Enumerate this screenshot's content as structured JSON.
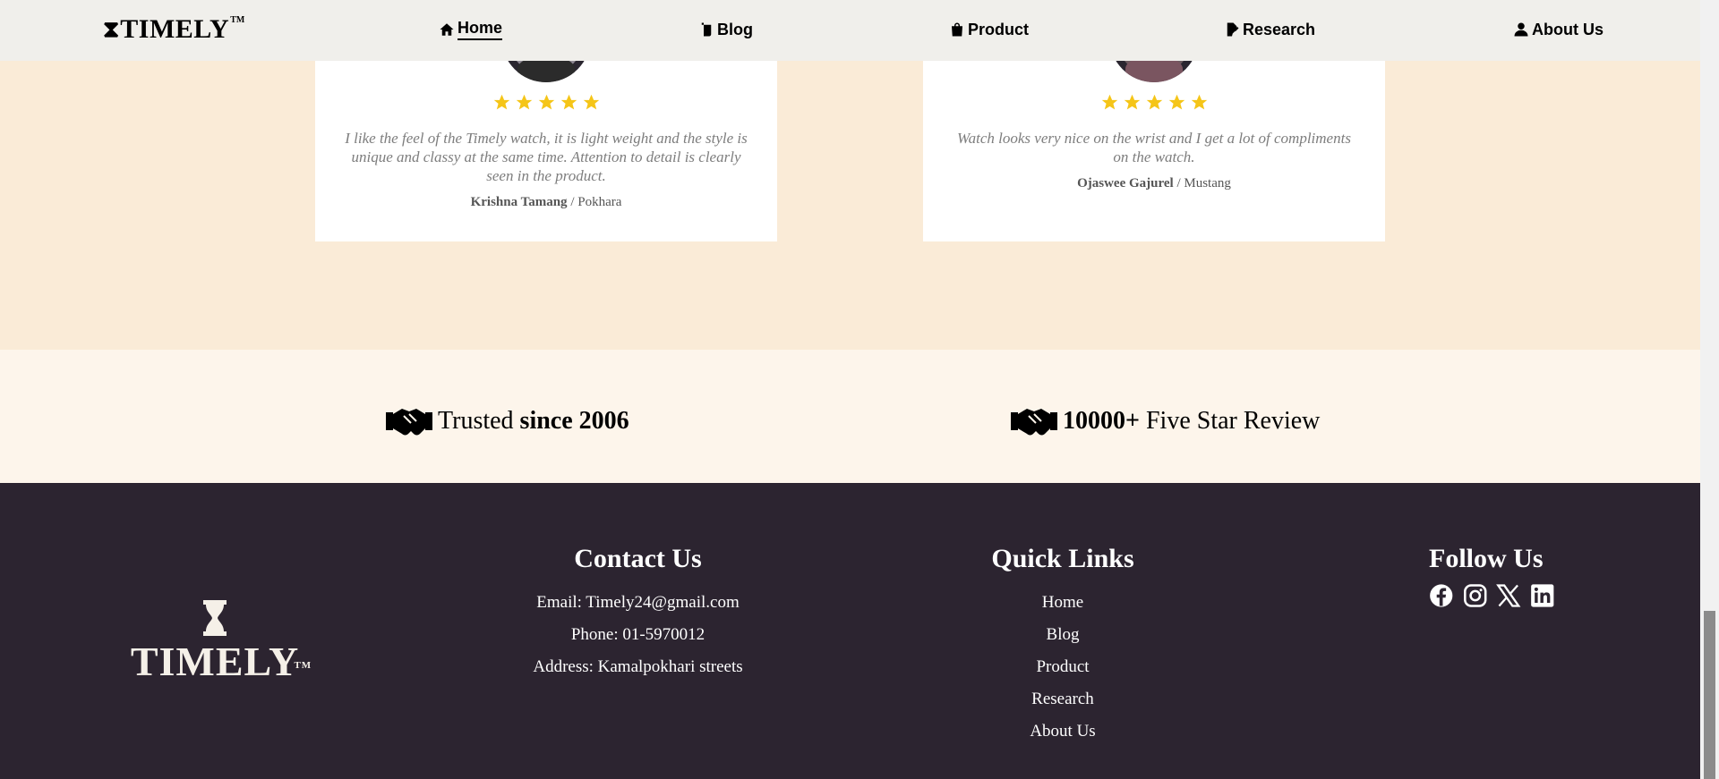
{
  "header": {
    "logo": {
      "text": "TIMELY",
      "tm": "TM"
    },
    "nav": [
      {
        "label": "Home",
        "icon": "home-icon",
        "active": true
      },
      {
        "label": "Blog",
        "icon": "blog-icon",
        "active": false
      },
      {
        "label": "Product",
        "icon": "shopping-bag-icon",
        "active": false
      },
      {
        "label": "Research",
        "icon": "research-doc-icon",
        "active": false
      },
      {
        "label": "About Us",
        "icon": "user-icon",
        "active": false
      }
    ]
  },
  "testimonials": [
    {
      "rating": 5,
      "quote": "I like the feel of the Timely watch, it is light weight and the style is unique and classy at the same time. Attention to detail is clearly seen in the product.",
      "name": "Krishna Tamang",
      "location": "/ Pokhara"
    },
    {
      "rating": 5,
      "quote": "Watch looks very nice on the wrist and I get a lot of compliments on the watch.",
      "name": "Ojaswee Gajurel",
      "location": "/ Mustang"
    }
  ],
  "trust": [
    {
      "icon": "handshake-icon",
      "before": "Trusted ",
      "bold": "since 2006",
      "after": ""
    },
    {
      "icon": "handshake-icon",
      "before": "",
      "bold": "10000+",
      "after": " Five Star Review"
    }
  ],
  "footer": {
    "logo": {
      "text": "TIMELY",
      "tm": "TM"
    },
    "contact": {
      "title": "Contact Us",
      "email": "Email: Timely24@gmail.com",
      "phone": "Phone: 01-5970012",
      "address": "Address: Kamalpokhari streets"
    },
    "quick_links": {
      "title": "Quick Links",
      "links": [
        "Home",
        "Blog",
        "Product",
        "Research",
        "About Us"
      ]
    },
    "follow": {
      "title": "Follow Us",
      "icons": [
        "facebook-icon",
        "instagram-icon",
        "x-icon",
        "linkedin-icon"
      ]
    }
  },
  "colors": {
    "header_bg": "#f0efeb",
    "section_bg": "#faebd7",
    "trust_bg": "#fdf5eb",
    "footer_bg": "#2c2430",
    "star": "#f5c518"
  }
}
